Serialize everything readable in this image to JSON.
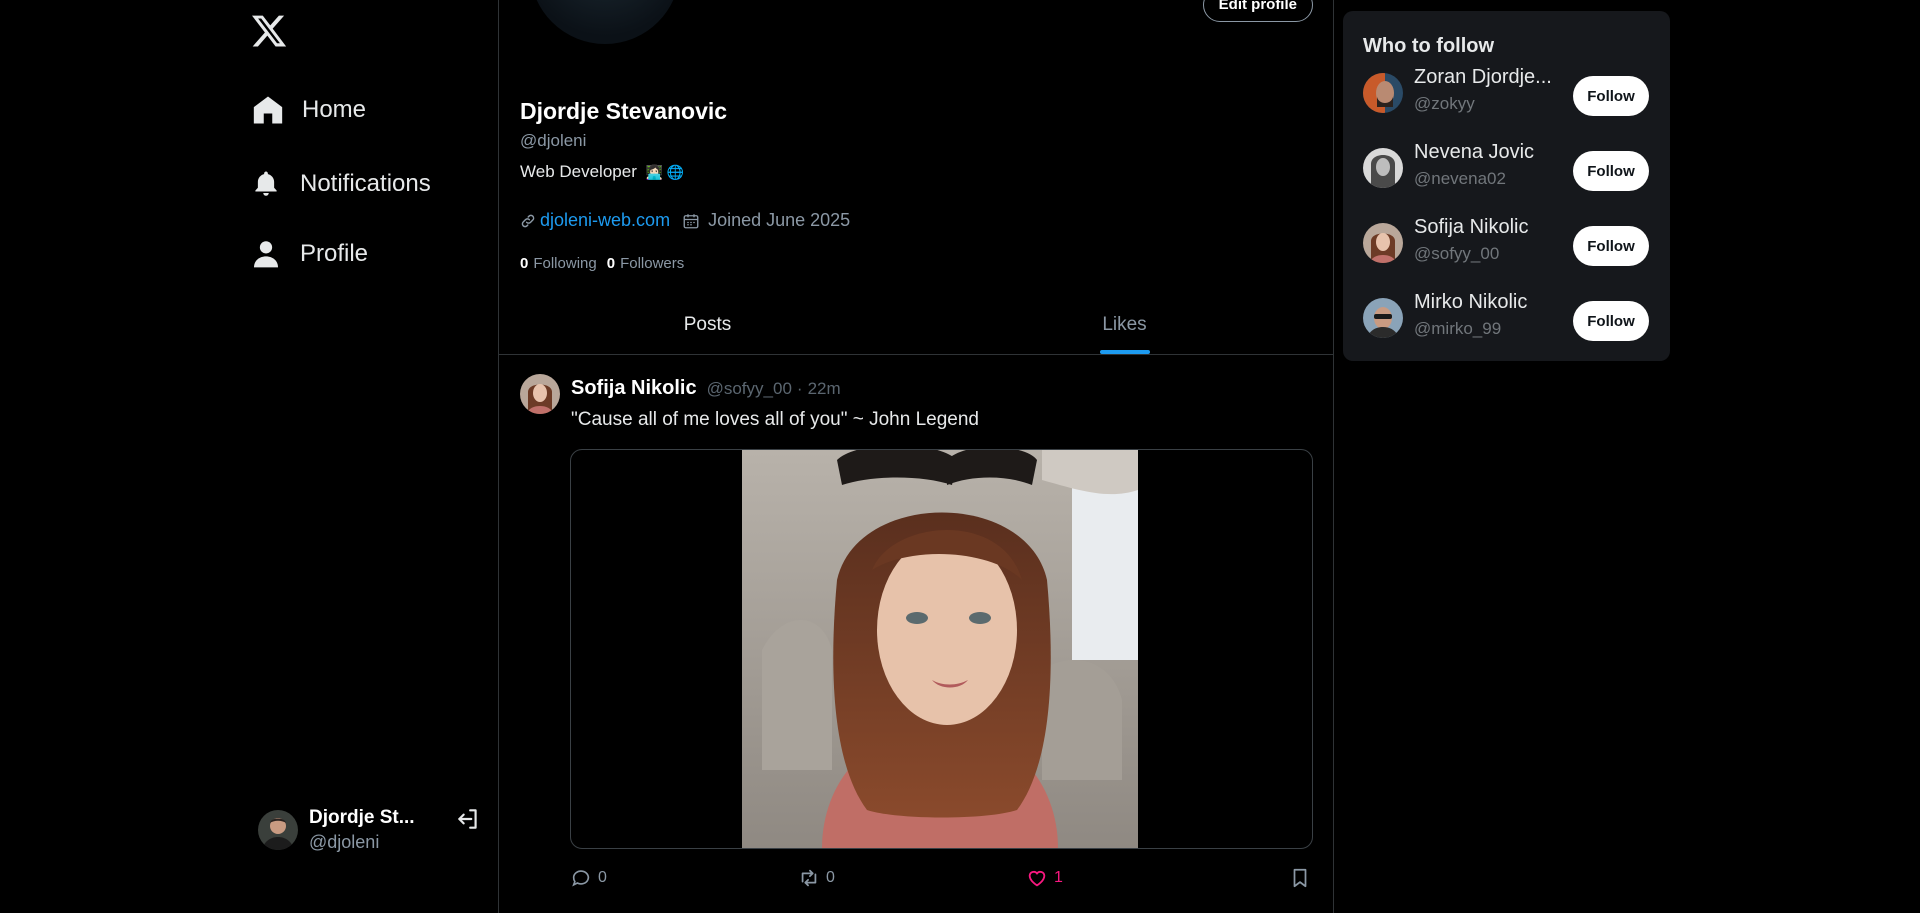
{
  "nav": {
    "items": [
      {
        "label": "Home",
        "icon": "home-icon"
      },
      {
        "label": "Notifications",
        "icon": "bell-icon"
      },
      {
        "label": "Profile",
        "icon": "user-icon"
      }
    ]
  },
  "account": {
    "name": "Djordje St...",
    "handle": "@djoleni"
  },
  "profile": {
    "edit_label": "Edit profile",
    "name": "Djordje Stevanovic",
    "handle": "@djoleni",
    "bio": "Web Developer",
    "bio_emoji": "👩🏻‍💻 🌐",
    "website": "djoleni-web.com",
    "joined": "Joined June 2025",
    "following_count": "0",
    "following_label": "Following",
    "followers_count": "0",
    "followers_label": "Followers"
  },
  "tabs": [
    {
      "label": "Posts",
      "active": false
    },
    {
      "label": "Likes",
      "active": true
    }
  ],
  "post": {
    "author": "Sofija Nikolic",
    "handle": "@sofyy_00",
    "separator": "·",
    "time": "22m",
    "text": "\"Cause all of me loves all of you\" ~ John Legend",
    "replies": "0",
    "retweets": "0",
    "likes": "1",
    "liked": true
  },
  "who_to_follow": {
    "title": "Who to follow",
    "button_label": "Follow",
    "users": [
      {
        "name": "Zoran Djordje...",
        "handle": "@zokyy"
      },
      {
        "name": "Nevena Jovic",
        "handle": "@nevena02"
      },
      {
        "name": "Sofija Nikolic",
        "handle": "@sofyy_00"
      },
      {
        "name": "Mirko Nikolic",
        "handle": "@mirko_99"
      }
    ]
  },
  "colors": {
    "accent": "#1d9bf0",
    "like": "#f91880",
    "background": "#000000",
    "panel": "#16181c"
  }
}
